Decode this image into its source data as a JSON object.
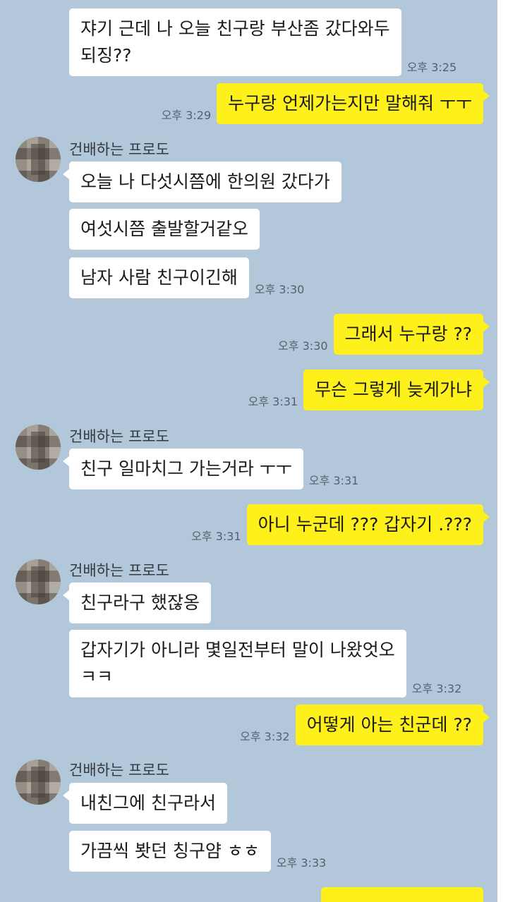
{
  "chat": {
    "partner_name": "건배하는 프로도",
    "messages": [
      {
        "side": "left",
        "text": "쟈기 근데 나 오늘 친구랑 부산좀 갔다와두\n되징??",
        "time": "오후 3:25"
      },
      {
        "side": "right",
        "text": "누구랑 언제가는지만 말해줘 ㅜㅜ",
        "time": "오후 3:29"
      },
      {
        "side": "left",
        "text": "오늘 나 다섯시쯤에 한의원 갔다가",
        "time": ""
      },
      {
        "side": "left",
        "text": "여섯시쯤 출발할거같오",
        "time": ""
      },
      {
        "side": "left",
        "text": "남자 사람 친구이긴해",
        "time": "오후 3:30"
      },
      {
        "side": "right",
        "text": "그래서 누구랑 ??",
        "time": "오후 3:30"
      },
      {
        "side": "right",
        "text": "무슨 그렇게 늦게가냐",
        "time": "오후 3:31"
      },
      {
        "side": "left",
        "text": "친구 일마치그 가는거라 ㅜㅜ",
        "time": "오후 3:31"
      },
      {
        "side": "right",
        "text": "아니 누군데 ??? 갑자기 .???",
        "time": "오후 3:31"
      },
      {
        "side": "left",
        "text": "친구라구 했잖옹",
        "time": ""
      },
      {
        "side": "left",
        "text": "갑자기가 아니라 몇일전부터 말이 나왔엇오\nㅋㅋ",
        "time": "오후 3:32"
      },
      {
        "side": "right",
        "text": "어떻게 아는 친군데 ??",
        "time": "오후 3:32"
      },
      {
        "side": "left",
        "text": "내친그에 친구라서",
        "time": ""
      },
      {
        "side": "left",
        "text": "가끔씩 봣던 칭구얌 ㅎㅎ",
        "time": "오후 3:33"
      }
    ]
  },
  "colors": {
    "background": "#b2c7d9",
    "my_bubble": "#fef01b",
    "their_bubble": "#ffffff"
  }
}
